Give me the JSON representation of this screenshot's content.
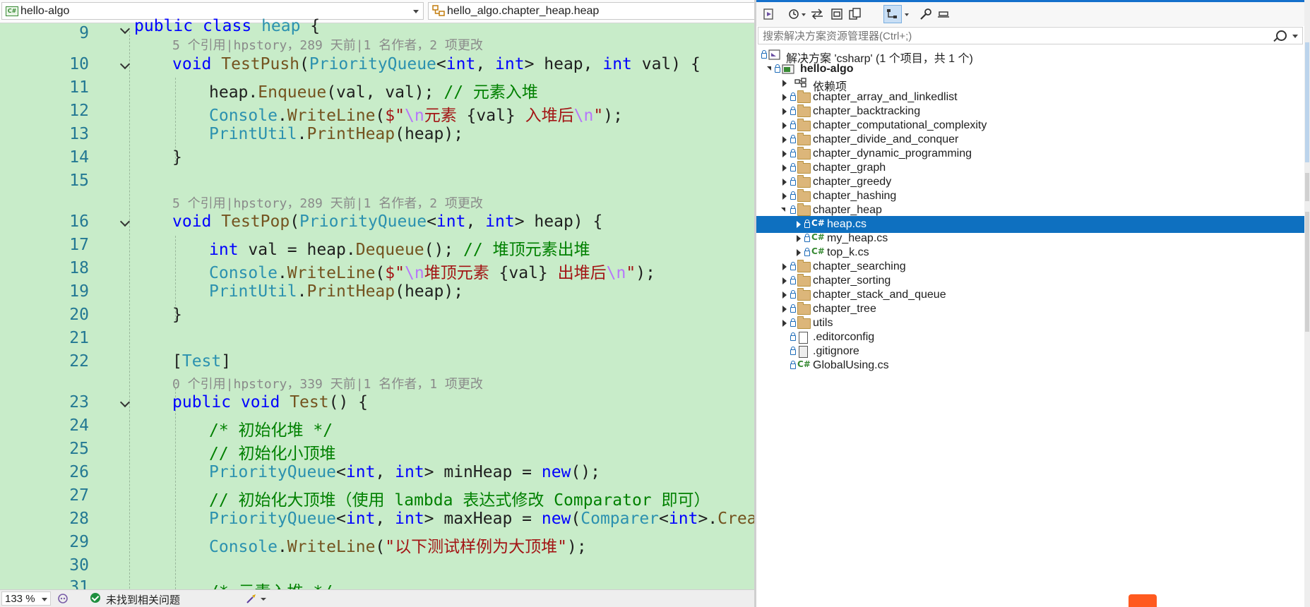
{
  "editor": {
    "nav": {
      "project": "hello-algo",
      "scope": "hello_algo.chapter_heap.heap"
    },
    "lens": {
      "push": "5 个引用|hpstory，289 天前|1 名作者，2 项更改",
      "pop": "5 个引用|hpstory，289 天前|1 名作者，2 项更改",
      "test": "0 个引用|hpstory，339 天前|1 名作者，1 项更改"
    },
    "lines": {
      "l9": {
        "n": "9",
        "t1": "public",
        "t2": " ",
        "t3": "class",
        "t4": " ",
        "t5": "heap",
        "t6": " {"
      },
      "l10": {
        "n": "10",
        "t1": "void",
        "t2": " ",
        "t3": "TestPush",
        "t4": "(",
        "t5": "PriorityQueue",
        "t6": "<",
        "t7": "int",
        "t8": ", ",
        "t9": "int",
        "t10": "> heap, ",
        "t11": "int",
        "t12": " val) {"
      },
      "l11": {
        "n": "11",
        "t1": "heap.",
        "t2": "Enqueue",
        "t3": "(val, val); ",
        "t4": "// 元素入堆"
      },
      "l12": {
        "n": "12",
        "t1": "Console",
        "t2": ".",
        "t3": "WriteLine",
        "t4": "(",
        "t5": "$\"",
        "t6": "\\n",
        "t7": "元素 ",
        "t8": "{val}",
        "t9": " 入堆后",
        "t10": "\\n",
        "t11": "\"",
        "t12": ");"
      },
      "l13": {
        "n": "13",
        "t1": "PrintUtil",
        "t2": ".",
        "t3": "PrintHeap",
        "t4": "(heap);"
      },
      "l14": {
        "n": "14",
        "t1": "}"
      },
      "l15": {
        "n": "15"
      },
      "l16": {
        "n": "16",
        "t1": "void",
        "t2": " ",
        "t3": "TestPop",
        "t4": "(",
        "t5": "PriorityQueue",
        "t6": "<",
        "t7": "int",
        "t8": ", ",
        "t9": "int",
        "t10": "> heap) {"
      },
      "l17": {
        "n": "17",
        "t1": "int",
        "t2": " val = heap.",
        "t3": "Dequeue",
        "t4": "(); ",
        "t5": "// 堆顶元素出堆"
      },
      "l18": {
        "n": "18",
        "t1": "Console",
        "t2": ".",
        "t3": "WriteLine",
        "t4": "(",
        "t5": "$\"",
        "t6": "\\n",
        "t7": "堆顶元素 ",
        "t8": "{val}",
        "t9": " 出堆后",
        "t10": "\\n",
        "t11": "\"",
        "t12": ");"
      },
      "l19": {
        "n": "19",
        "t1": "PrintUtil",
        "t2": ".",
        "t3": "PrintHeap",
        "t4": "(heap);"
      },
      "l20": {
        "n": "20",
        "t1": "}"
      },
      "l21": {
        "n": "21"
      },
      "l22": {
        "n": "22",
        "t1": "[",
        "t2": "Test",
        "t3": "]"
      },
      "l23": {
        "n": "23",
        "t1": "public",
        "t2": " ",
        "t3": "void",
        "t4": " ",
        "t5": "Test",
        "t6": "() {"
      },
      "l24": {
        "n": "24",
        "t1": "/* 初始化堆 */"
      },
      "l25": {
        "n": "25",
        "t1": "// 初始化小顶堆"
      },
      "l26": {
        "n": "26",
        "t1": "PriorityQueue",
        "t2": "<",
        "t3": "int",
        "t4": ", ",
        "t5": "int",
        "t6": "> minHeap = ",
        "t7": "new",
        "t8": "();"
      },
      "l27": {
        "n": "27",
        "t1": "// 初始化大顶堆（使用 lambda 表达式修改 Comparator 即可）"
      },
      "l28": {
        "n": "28",
        "t1": "PriorityQueue",
        "t2": "<",
        "t3": "int",
        "t4": ", ",
        "t5": "int",
        "t6": "> maxHeap = ",
        "t7": "new",
        "t8": "(",
        "t9": "Comparer",
        "t10": "<",
        "t11": "int",
        "t12": ">.",
        "t13": "Create"
      },
      "l29": {
        "n": "29",
        "t1": "Console",
        "t2": ".",
        "t3": "WriteLine",
        "t4": "(",
        "t5": "\"以下测试样例为大顶堆\"",
        "t6": ");"
      },
      "l30": {
        "n": "30"
      },
      "l31": {
        "n": "31",
        "t1": "/* 元素入堆 */"
      }
    }
  },
  "status": {
    "zoom": "133 %",
    "issues": "未找到相关问题"
  },
  "solution_explorer": {
    "search_placeholder": "搜索解决方案资源管理器(Ctrl+;)",
    "solution": "解决方案 'csharp' (1 个项目，共 1 个)",
    "project": "hello-algo",
    "dependencies": "依赖项",
    "folders": {
      "f1": "chapter_array_and_linkedlist",
      "f2": "chapter_backtracking",
      "f3": "chapter_computational_complexity",
      "f4": "chapter_divide_and_conquer",
      "f5": "chapter_dynamic_programming",
      "f6": "chapter_graph",
      "f7": "chapter_greedy",
      "f8": "chapter_hashing",
      "f9": "chapter_heap"
    },
    "heap_files": {
      "a": "heap.cs",
      "b": "my_heap.cs",
      "c": "top_k.cs"
    },
    "folders2": {
      "f10": "chapter_searching",
      "f11": "chapter_sorting",
      "f12": "chapter_stack_and_queue",
      "f13": "chapter_tree",
      "f14": "utils"
    },
    "root_files": {
      "editorconfig": ".editorconfig",
      "gitignore": ".gitignore",
      "globalusing": "GlobalUsing.cs"
    },
    "cs_label": "C#"
  },
  "colors": {
    "editor_bg": "#c8ecc9",
    "selection": "#0e70c0",
    "accent": "#1470cc"
  }
}
